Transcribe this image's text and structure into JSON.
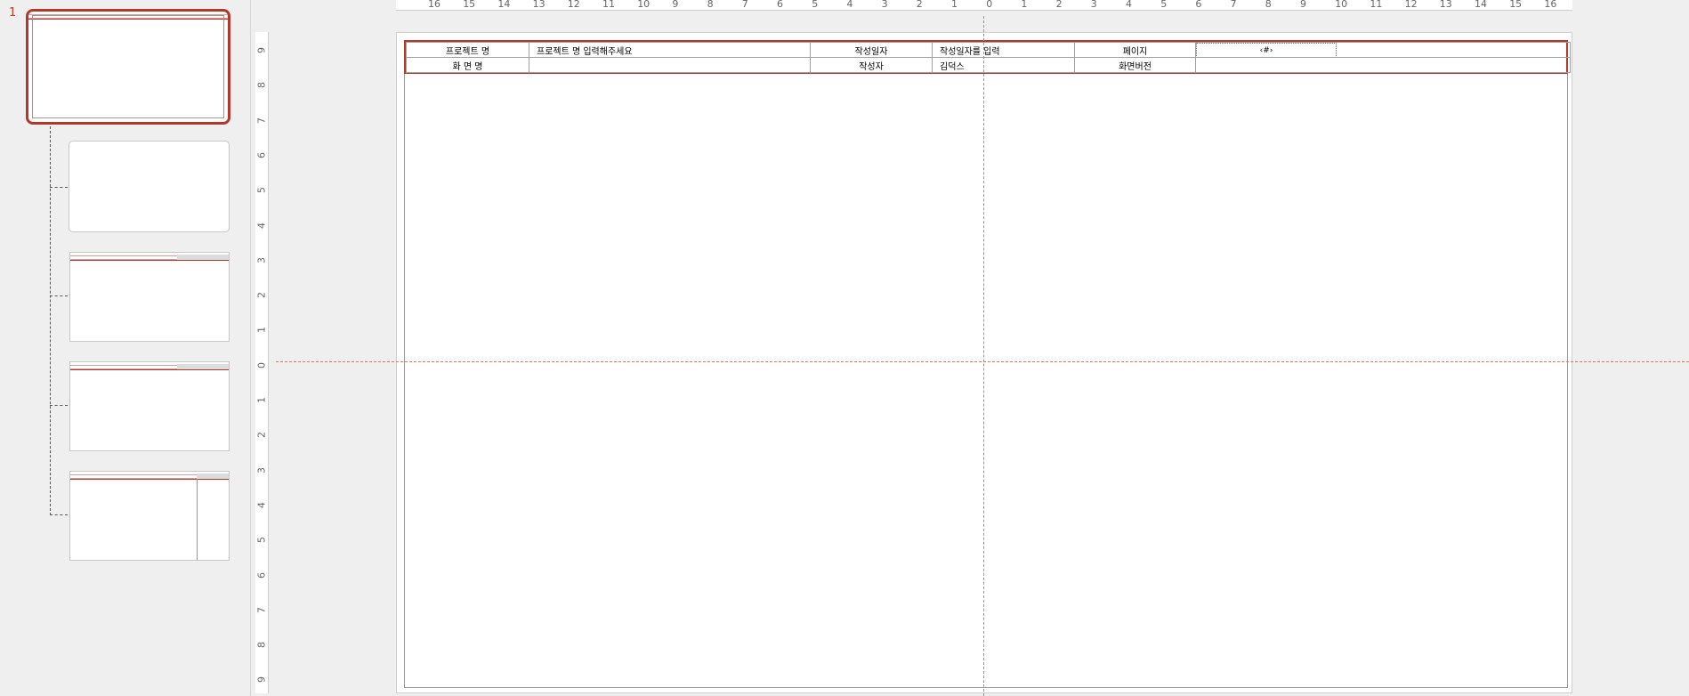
{
  "thumbnail_panel": {
    "active_slide_number": "1"
  },
  "ruler_top": {
    "labels": [
      "16",
      "15",
      "14",
      "13",
      "12",
      "11",
      "10",
      "9",
      "8",
      "7",
      "6",
      "5",
      "4",
      "3",
      "2",
      "1",
      "0",
      "1",
      "2",
      "3",
      "4",
      "5",
      "6",
      "7",
      "8",
      "9",
      "10",
      "11",
      "12",
      "13",
      "14",
      "15",
      "16"
    ]
  },
  "ruler_left": {
    "labels": [
      "9",
      "8",
      "7",
      "6",
      "5",
      "4",
      "3",
      "2",
      "1",
      "0",
      "1",
      "2",
      "3",
      "4",
      "5",
      "6",
      "7",
      "8",
      "9"
    ]
  },
  "header": {
    "project_label": "프로젝트 명",
    "project_value": "프로젝트 명 입력해주세요",
    "date_label": "작성일자",
    "date_value": "작성일자를 입력",
    "page_label": "페이지",
    "page_value": "‹#›",
    "screen_label": "화 면 명",
    "screen_value": "",
    "author_label": "작성자",
    "author_value": "김덕스",
    "version_label": "화면버전",
    "version_value": ""
  },
  "colors": {
    "accent": "#b3382c",
    "guide": "#e07a5f"
  }
}
